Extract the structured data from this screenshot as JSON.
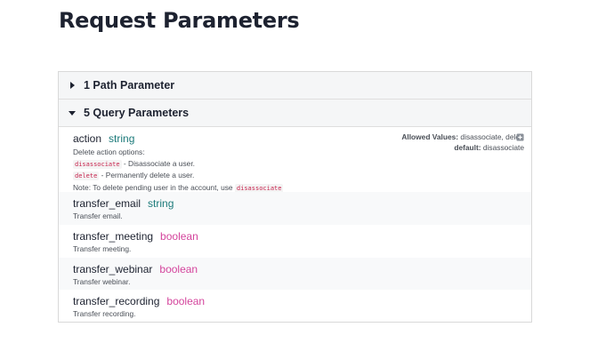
{
  "page_title": "Request Parameters",
  "sections": {
    "path": {
      "label": "1 Path Parameter",
      "expanded": false
    },
    "query": {
      "label": "5 Query Parameters",
      "expanded": true
    }
  },
  "params": {
    "action": {
      "name": "action",
      "type": "string",
      "desc_intro": "Delete action options:",
      "option1_code": "disassociate",
      "option1_text": " - Disassociate a user.",
      "option2_code": "delete",
      "option2_text": " - Permanently delete a user.",
      "note": "Note: To delete pending user in the account, use ",
      "note_code": "disassociate",
      "allowed_label": "Allowed Values:",
      "allowed_value": " disassociate, dele",
      "default_label": "default:",
      "default_value": " disassociate",
      "expand_icon": "expand-icon"
    },
    "transfer_email": {
      "name": "transfer_email",
      "type": "string",
      "desc": "Transfer email."
    },
    "transfer_meeting": {
      "name": "transfer_meeting",
      "type": "boolean",
      "desc": "Transfer meeting."
    },
    "transfer_webinar": {
      "name": "transfer_webinar",
      "type": "boolean",
      "desc": "Transfer webinar."
    },
    "transfer_recording": {
      "name": "transfer_recording",
      "type": "boolean",
      "desc": "Transfer recording."
    }
  },
  "colors": {
    "string_type": "#1c7a7a",
    "boolean_type": "#d4449c",
    "code": "#c7254e"
  }
}
